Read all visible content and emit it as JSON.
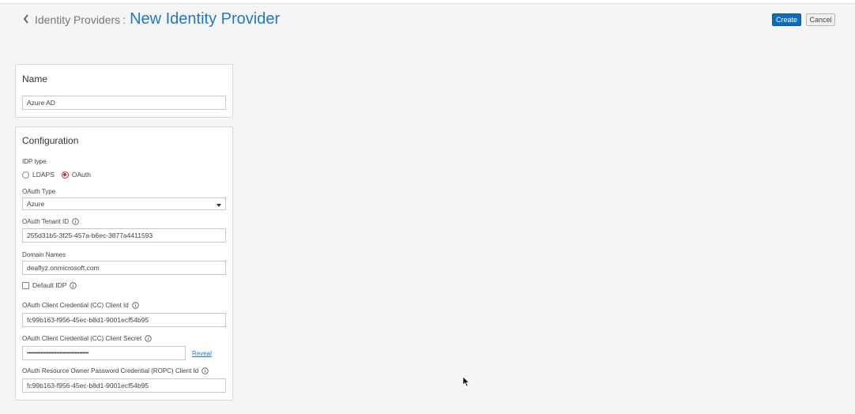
{
  "header": {
    "breadcrumb_parent": "Identity Providers",
    "breadcrumb_separator": ":",
    "title": "New Identity Provider"
  },
  "actions": {
    "create_label": "Create",
    "cancel_label": "Cancel"
  },
  "name_section": {
    "title": "Name",
    "value": "Azure AD"
  },
  "config_section": {
    "title": "Configuration",
    "idp_type_label": "IDP type",
    "idp_type_options": [
      "LDAPS",
      "OAuth"
    ],
    "idp_type_selected": "OAuth",
    "oauth_type_label": "OAuth Type",
    "oauth_type_value": "Azure",
    "tenant_id_label": "OAuth Tenant ID",
    "tenant_id_value": "255d31b5-3f25-457a-b6ec-3877a4411593",
    "domain_names_label": "Domain Names",
    "domain_names_value": "deaflyz.onmicrosoft.com",
    "default_idp_label": "Default IDP",
    "default_idp_checked": false,
    "cc_client_id_label": "OAuth Client Credential (CC) Client Id",
    "cc_client_id_value": "fc99b163-f956-45ec-b8d1-9001ecf54b95",
    "cc_client_secret_label": "OAuth Client Credential (CC) Client Secret",
    "cc_client_secret_value": "••••••••••••••••••••••••••••••••••••••••",
    "reveal_label": "Reveal",
    "ropc_client_id_label": "OAuth Resource Owner Password Credential (ROPC) Client Id",
    "ropc_client_id_value": "fc99b163-f956-45ec-b8d1-9001ecf54b95"
  },
  "colors": {
    "accent": "#1f78c8",
    "primary_button": "#0f6cbd",
    "radio_selected": "#d12d2d"
  },
  "icons": {
    "back": "chevron-left-icon",
    "info": "info-circle-icon",
    "cursor": "mouse-pointer-icon"
  }
}
